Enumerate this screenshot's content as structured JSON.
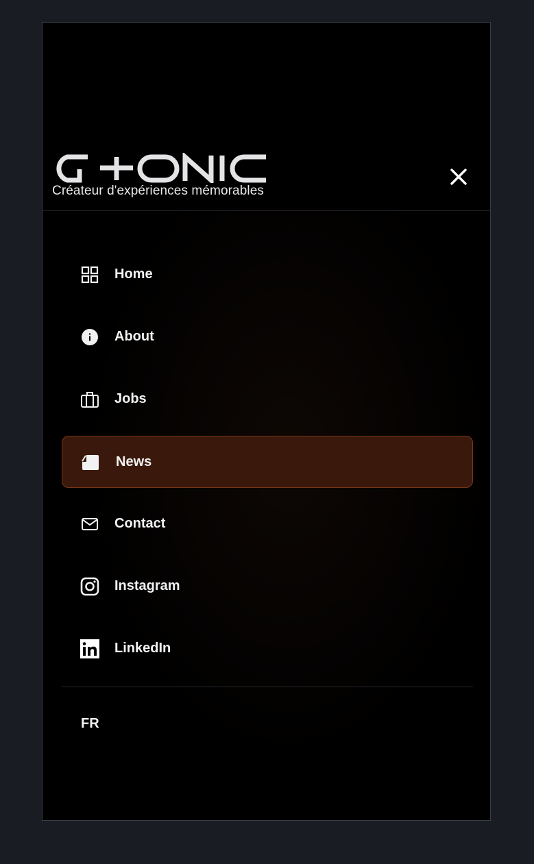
{
  "brand": {
    "logo_text": "G+ONIC",
    "tagline": "Créateur d'expériences mémorables"
  },
  "nav": {
    "items": [
      {
        "label": "Home",
        "icon": "grid-icon",
        "active": false
      },
      {
        "label": "About",
        "icon": "info-icon",
        "active": false
      },
      {
        "label": "Jobs",
        "icon": "briefcase-icon",
        "active": false
      },
      {
        "label": "News",
        "icon": "news-icon",
        "active": true
      },
      {
        "label": "Contact",
        "icon": "mail-icon",
        "active": false
      },
      {
        "label": "Instagram",
        "icon": "instagram-icon",
        "active": false
      },
      {
        "label": "LinkedIn",
        "icon": "linkedin-icon",
        "active": false
      }
    ]
  },
  "language": {
    "current": "FR"
  },
  "colors": {
    "page_bg": "#1a1c24",
    "panel_bg": "#000000",
    "active_bg": "#3a190c",
    "active_border": "#7a3518",
    "text": "#f2f2f2"
  }
}
